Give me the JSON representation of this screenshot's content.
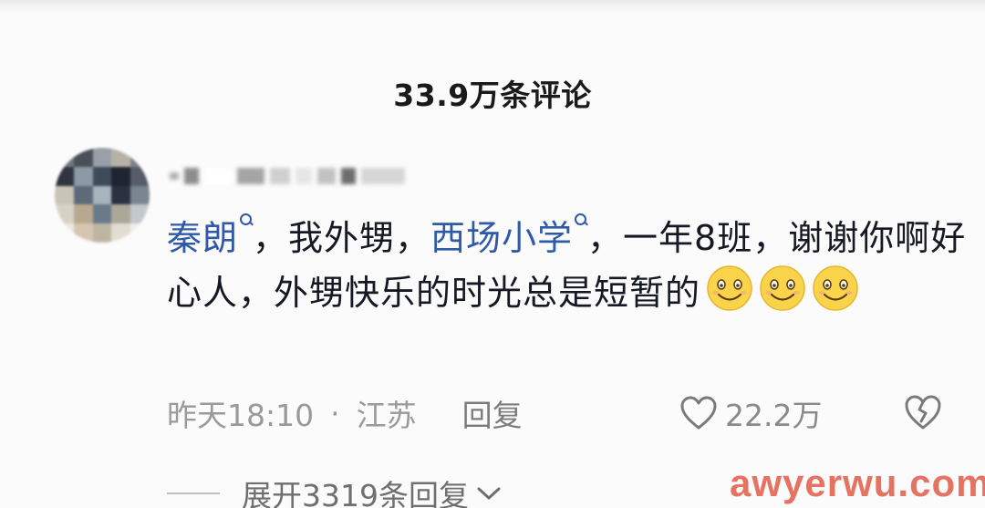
{
  "header": {
    "comment_count": "33.9万条评论"
  },
  "comment": {
    "body": {
      "part1_link": "秦朗",
      "part2": "，我外甥，",
      "part3_link": "西场小学",
      "part4": "，一年8班，谢谢你啊好心人，外甥快乐的时光总是短暂的"
    },
    "emoji_count": 3,
    "emoji_name": "smiling-face",
    "meta": {
      "time": "昨天18:10",
      "dot": "·",
      "location": "江苏",
      "reply_label": "回复"
    },
    "likes": "22.2万",
    "expand_label": "展开3319条回复"
  },
  "watermark": "awyerwu.com",
  "colors": {
    "link": "#2f5aa8",
    "meta_text": "#9a9a9a",
    "watermark": "#e25a46"
  }
}
